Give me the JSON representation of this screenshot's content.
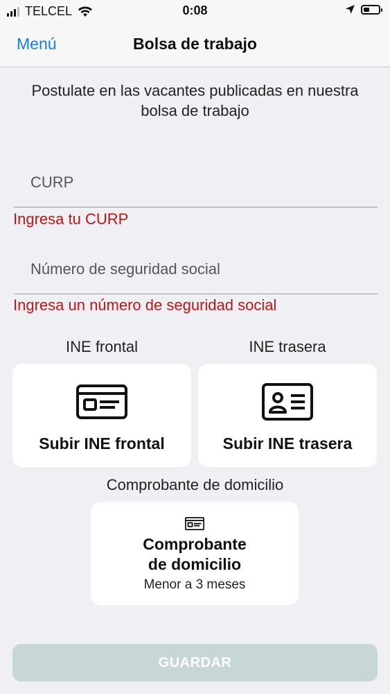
{
  "status_bar": {
    "carrier": "TELCEL",
    "time": "0:08",
    "battery_level": 0.4
  },
  "nav": {
    "back_label": "Menú",
    "title": "Bolsa de trabajo"
  },
  "intro_text": "Postulate en las vacantes publicadas en nuestra bolsa de trabajo",
  "form": {
    "curp": {
      "placeholder": "CURP",
      "value": "",
      "error": "Ingresa tu CURP"
    },
    "nss": {
      "placeholder": "Número de seguridad social",
      "value": "",
      "error": "Ingresa un número de seguridad social"
    }
  },
  "uploads": {
    "ine_front": {
      "label": "INE frontal",
      "button": "Subir INE frontal",
      "icon": "id-card-icon"
    },
    "ine_back": {
      "label": "INE trasera",
      "button": "Subir INE trasera",
      "icon": "id-card-person-icon"
    },
    "proof_of_address": {
      "label": "Comprobante de domicilio",
      "title_line1": "Comprobante",
      "title_line2": "de domicilio",
      "subtitle": "Menor a 3 meses",
      "icon": "id-card-icon"
    }
  },
  "save_button": "GUARDAR",
  "colors": {
    "accent": "#1a7de0",
    "error": "#c01616",
    "background": "#efeff4",
    "save_disabled": "#c7d6d6"
  }
}
